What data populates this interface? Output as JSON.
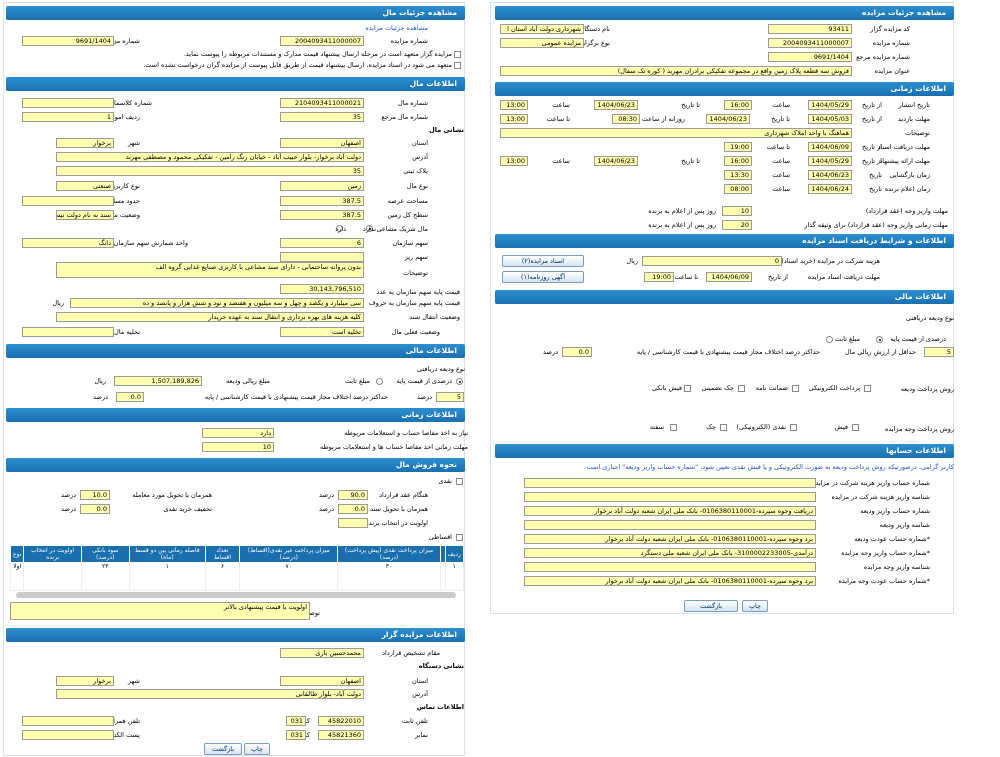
{
  "right": {
    "sections": {
      "details": "مشاهده جزئیات مزایده",
      "time": "اطلاعات زمانی",
      "conditions": "اطلاعات و شرایط دریافت اسناد مزایده",
      "financial": "اطلاعات مالی",
      "accounts": "اطلاعات حسابها"
    },
    "details": {
      "org_code_label": "کد مزایده گزار",
      "org_code": "93411",
      "org_name_label": "نام دستگاه مزایده گزار",
      "org_name": "شهرداری دولت آباد استان ا",
      "auction_no_label": "شماره مزایده",
      "auction_no": "2004093411000007",
      "type_label": "نوع برگزاری مزایده",
      "type": "مزایده عمومی",
      "ref_no_label": "شماره مزایده مرجع",
      "ref_no": "9691/1404",
      "title_label": "عنوان مزایده",
      "title": "فروش سه قطعه پلاک زمین واقع در مجموعه تفکیکی برادران مهربد ( کوره تک سفال)"
    },
    "time": {
      "publish_label": "تاریخ انتشار",
      "publish_from_label": "از تاریخ",
      "publish_from": "1404/05/29",
      "publish_time_label": "ساعت",
      "publish_time": "16:00",
      "publish_to_label": "تا تاریخ",
      "publish_to": "1404/06/23",
      "publish_to_time_label": "ساعت",
      "publish_to_time": "13:00",
      "visit_label": "مهلت بازدید",
      "visit_from_label": "از تاریخ",
      "visit_from": "1404/05/03",
      "visit_to_label": "تا تاریخ",
      "visit_to": "1404/06/23",
      "visit_daily_label": "روزانه از ساعت",
      "visit_daily_from": "08:30",
      "visit_daily_to_label": "تا ساعت",
      "visit_daily_to": "13:00",
      "desc_label": "توضیحات",
      "desc": "هماهنگ با واحد املاک شهرداری",
      "docs_label": "مهلت دریافت اسناد",
      "docs_from_label": "از تاریخ",
      "docs_from": "1404/06/09",
      "docs_to_label": "تا ساعت",
      "docs_to": "19:00",
      "offer_label": "مهلت ارائه پیشنهاد",
      "offer_from_label": "از تاریخ",
      "offer_from": "1404/05/29",
      "offer_time_label": "ساعت",
      "offer_time": "16:00",
      "offer_to_label": "تا تاریخ",
      "offer_to": "1404/06/23",
      "offer_to_time_label": "ساعت",
      "offer_to_time": "13:00",
      "opening_label": "زمان بازگشایی",
      "opening_date_label": "تاریخ",
      "opening_date": "1404/06/23",
      "opening_time_label": "ساعت",
      "opening_time": "13:30",
      "announce_label": "زمان اعلام برنده",
      "announce_date_label": "تاریخ",
      "announce_date": "1404/06/24",
      "announce_time_label": "ساعت",
      "announce_time": "08:00",
      "contract_label": "مهلت واریز وجه (عقد قرارداد)",
      "contract_days": "10",
      "contract_suffix": "روز پس از اعلام به برنده",
      "guarantee_label": "مهلت زمانی واریز وجه (عقد قرارداد) برای وثیقه گذار",
      "guarantee_days": "20",
      "guarantee_suffix": "روز پس از اعلام به برنده"
    },
    "conditions": {
      "fee_label": "هزینه شرکت در مزایده (خرید اسناد)",
      "fee": "0",
      "fee_unit": "ریال",
      "docs_btn": "اسناد مزایده(۲)",
      "ads_btn": "آگهی روزنامه(۱)",
      "deadline_label": "مهلت دریافت اسناد مزایده",
      "deadline_from_label": "از تاریخ",
      "deadline_date": "1404/06/09",
      "deadline_time_label": "تا ساعت",
      "deadline_time": "19:00"
    },
    "financial": {
      "deposit_type_label": "نوع ودیعه دریافتی",
      "fixed_label": "مبلغ ثابت",
      "percent_label": "درصدی از قیمت پایه",
      "min_label": "حداقل از ارزش ریالی مال",
      "min_value": "5",
      "min_unit": "درصد",
      "max_label": "حداکثر درصد اختلاف مجاز قیمت پیشنهادی با قیمت کارشناسی / پایه",
      "max_value": "0.0",
      "max_unit": "درصد",
      "method_label": "روش پرداخت ودیعه",
      "m_electronic": "پرداخت الکترونیکی",
      "m_guarantee": "ضمانت نامه",
      "m_cheque": "چک تضمینی",
      "m_receipt": "فیش بانکی",
      "price_method_label": "روش پرداخت وجه مزایده",
      "p_cash": "فیش",
      "p_elec": "نقدی (الکترونیکی)",
      "p_cheque": "چک",
      "p_bond": "سفته"
    },
    "accounts": {
      "note": "کاربر گرامی، درصورتیکه روش پرداخت ودیعه به صورت الکترونیکی و یا فیش نقدی تعیین شود، \"شماره حساب واریز ودیعه\" اجباری است.",
      "rows": [
        {
          "label": "شماره حساب واریز هزینه شرکت در مزایده",
          "value": ""
        },
        {
          "label": "شناسه واریز هزینه شرکت در مزایده",
          "value": ""
        },
        {
          "label": "شماره حساب واریز ودیعه",
          "value": "دریافت وجوه سپرده-0106380110001- بانک ملی ایران شعبه دولت آباد برخوار"
        },
        {
          "label": "شناسه واریز ودیعه",
          "value": ""
        },
        {
          "label": "*شماره حساب عودت ودیعه",
          "value": "برد وجوه سپرده-0106380110001- بانک ملی ایران شعبه دولت آباد برخوار"
        },
        {
          "label": "*شماره حساب واریز وجه مزایده",
          "value": "درآمدی-3100002233005- بانک ملی ایران شعبه ملی دستگرد"
        },
        {
          "label": "شناسه واریز وجه مزایده",
          "value": ""
        },
        {
          "label": "*شماره حساب عودت وجه مزایده",
          "value": "برد وجوه سپرده-0106380110001- بانک ملی ایران شعبه دولت آباد برخوار"
        }
      ]
    },
    "print_btn": "چاپ",
    "back_btn": "بازگشت"
  },
  "left": {
    "sections": {
      "property_details": "مشاهده جزئیات مال",
      "property_info": "اطلاعات مال",
      "address": "نشانی مال",
      "financial": "اطلاعات مالی",
      "time": "اطلاعات زمانی",
      "sale": "نحوه فروش مال",
      "organizer": "اطلاعات مزایده گزار",
      "org_address": "نشانی دستگاه",
      "contact": "اطلاعات تماس"
    },
    "link": "مشاهده جزئیات مزایده",
    "auction_no_label": "شماره مزایده",
    "auction_no": "2004093411000007",
    "ref_no_label": "شماره مزایده مرجع",
    "ref_no": "9691/1404",
    "note1": "مزایده گزار متعهد است در مرحله ارسال پیشنهاد قیمت مدارک و مستندات مربوطه را پیوست نماید.",
    "note2": "متعهد می شود در اسناد مزایده، ارسال پیشنهاد قیمت از طریق فایل پیوست از مزایده گران درخواست نشده است.",
    "property": {
      "no_label": "شماره مال",
      "no": "2104093411000021",
      "class_label": "شماره کلاسمان",
      "ref_label": "شماره مال مرجع",
      "ref": "35",
      "row_label": "ردیف اموال",
      "row": "1",
      "province_label": "استان",
      "province": "اصفهان",
      "city_label": "شهر",
      "city": "برخوار",
      "address_label": "آدرس",
      "address": "دولت آباد برخوار- بلوار حبیب آباد - خیابان رنگ رامین - تفکیکی محمود و مصطفی مهربد",
      "plate_label": "پلاک ثبتی",
      "plate": "35",
      "type_label": "نوع مال",
      "type": "زمین",
      "use_label": "نوع کاربری",
      "use": "صنعتی",
      "area_label": "مساحت عرصه",
      "area": "387.5",
      "bounds_label": "حدود مساحت اعیان",
      "land_label": "سطح کل زمین",
      "land": "387.5",
      "doc_label": "وضعیت سند",
      "doc": "سند به نام دولت نیست",
      "share_label": "مال شریک مشاعی",
      "share_no": "ندارد",
      "share_yes": "دارد",
      "share_org_label": "سهم سازمان",
      "share_org": "6",
      "share_unit_label": "واحد شمارش سهم سازمان",
      "share_unit": "دانگ",
      "share_small_label": "سهم ریز",
      "desc_label": "توضیحات",
      "desc": "بدون پروانه ساختمانی - دارای سند مشاعی با کاربری صنایع غذایی گروه الف",
      "base_price_label": "قیمت پایه سهم سازمان به عدد",
      "base_price": "30,143,796,510",
      "base_words_label": "قیمت پایه سهم سازمان به حروف",
      "base_words": "سی میلیارد و یکصد و چهل و سه میلیون و هفتصد و نود و شش هزار و پانصد و ده",
      "base_unit": "ریال",
      "transfer_label": "وضعیت انتقال سند",
      "transfer": "کلیه هزینه های بهره برداری و انتقال سند به عهده خریدار",
      "occupancy_label": "وضعیت فعلی مال",
      "occupancy": "تخلیه است",
      "evac_label": "تخلیه مال"
    },
    "financial": {
      "deposit_type_label": "نوع ودیعه دریافتی",
      "percent_label": "درصدی از قیمت پایه",
      "fixed_label": "مبلغ ثابت",
      "amount_label": "مبلغ ریالی ودیعه",
      "amount": "1,507,189,826",
      "amount_unit": "ریال",
      "min_label": "حداقل از ارزش ریالی مال",
      "min": "5",
      "min_unit": "درصد",
      "max_label": "حداکثر درصد اختلاف مجاز قیمت پیشنهادی با قیمت کارشناسی / پایه",
      "max": "0.0",
      "max_unit": "درصد"
    },
    "time": {
      "need_label": "نیاز به اخذ مفاصا حساب و استعلامات مربوطه",
      "need": "دارد",
      "deadline_label": "مهلت زمانی اخذ مفاصا حساب ها و استعلامات مربوطه",
      "deadline": "10"
    },
    "sale": {
      "cash_label": "نقدی",
      "contract_label": "هنگام عقد قرارداد",
      "contract": "90.0",
      "contract_unit": "درصد",
      "with_deal_label": "همزمان با تحویل مورد معامله",
      "with_deal": "10.0",
      "with_deal_unit": "درصد",
      "with_doc_label": "همزمان با تحویل سند",
      "with_doc": "0.0",
      "with_doc_unit": "درصد",
      "discount_label": "تخفیف خرید نقدی",
      "discount": "0.0",
      "discount_unit": "درصد",
      "priority_label": "اولویت در انتخاب برنده",
      "installment_label": "اقساطی",
      "table_headers": [
        "ردیف",
        "میزان پرداخت نقدی (پیش پرداخت) (درصد)",
        "میزان پرداخت غیر نقدی(اقساط) (درصد)",
        "تعداد اقساط",
        "فاصله زمانی بین دو قسط (ماه)",
        "سود بانکی (درصد)",
        "اولویت در انتخاب برنده",
        "نوع"
      ],
      "table_rows": [
        [
          "۱",
          "۳۰",
          "۷۰",
          "۶",
          "۱",
          "۲۳",
          "",
          "اولا"
        ]
      ],
      "desc_label": "توضیحات",
      "desc": "اولویت با قیمت پیشنهادی بالاتر"
    },
    "organizer": {
      "signer_label": "مقام تشخیص قرارداد",
      "signer": "محمدحسین باری",
      "province_label": "استان",
      "province": "اصفهان",
      "city_label": "شهر",
      "city": "برخوار",
      "address_label": "آدرس",
      "address": "دولت آباد- بلوار طالقانی",
      "phone_label": "تلفن ثابت",
      "phone": "45822010",
      "phone_code_label": "کد",
      "phone_code": "031",
      "mobile_label": "تلفن همراه",
      "fax_label": "نمابر",
      "fax": "45821360",
      "fax_code_label": "کد",
      "fax_code": "031",
      "email_label": "پست الکترونیکی"
    },
    "print_btn": "چاپ",
    "back_btn": "بازگشت"
  },
  "colors": {
    "header": "#1a6fae",
    "field": "#ffffb0",
    "link": "#2256c8"
  }
}
